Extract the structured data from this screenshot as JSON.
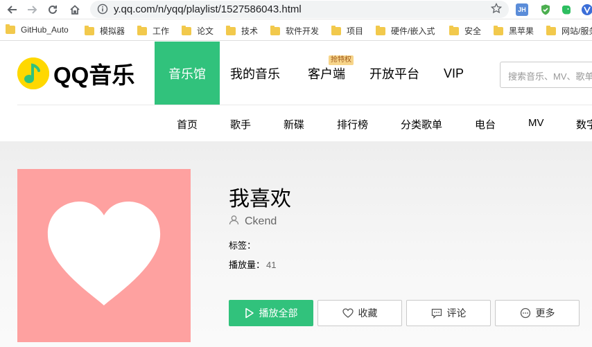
{
  "browser": {
    "url": "y.qq.com/n/yqq/playlist/1527586043.html",
    "extension_label": "JH",
    "bookmarks": [
      {
        "label": "GitHub_Auto"
      },
      {
        "label": "模拟器"
      },
      {
        "label": "工作"
      },
      {
        "label": "论文"
      },
      {
        "label": "技术"
      },
      {
        "label": "软件开发"
      },
      {
        "label": "项目"
      },
      {
        "label": "硬件/嵌入式"
      },
      {
        "label": "安全"
      },
      {
        "label": "黑苹果"
      },
      {
        "label": "网站/服务"
      }
    ]
  },
  "header": {
    "logo_text": "QQ音乐",
    "nav": [
      {
        "label": "音乐馆",
        "active": true
      },
      {
        "label": "我的音乐"
      },
      {
        "label": "客户端",
        "badge": "抢特权"
      },
      {
        "label": "开放平台"
      },
      {
        "label": "VIP"
      }
    ],
    "search_placeholder": "搜索音乐、MV、歌单",
    "subnav": [
      "首页",
      "歌手",
      "新碟",
      "排行榜",
      "分类歌单",
      "电台",
      "MV",
      "数字专辑"
    ]
  },
  "playlist": {
    "title": "我喜欢",
    "creator": "Ckend",
    "tags_label": "标签：",
    "tags_value": "",
    "plays_label": "播放量：",
    "plays_value": "41"
  },
  "actions": {
    "play_all": "播放全部",
    "favorite": "收藏",
    "comment": "评论",
    "more": "更多"
  },
  "colors": {
    "brand_green": "#31c27c",
    "cover_pink": "#fea1a0",
    "logo_yellow": "#ffd800"
  }
}
